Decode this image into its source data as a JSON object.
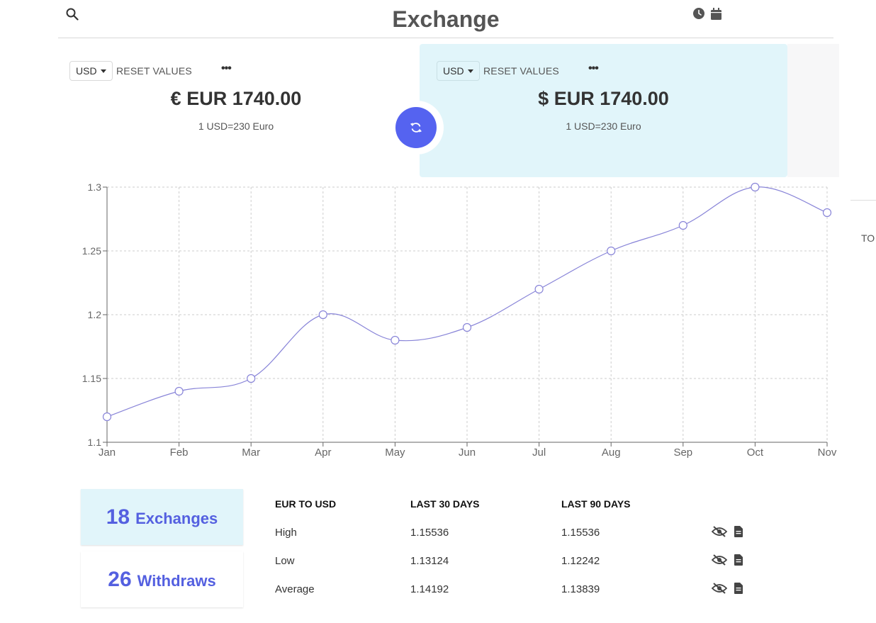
{
  "header": {
    "title": "Exchange",
    "search_icon": "search-icon",
    "history_icon": "clock-icon",
    "calendar_icon": "calendar-icon"
  },
  "from_panel": {
    "currency": "USD",
    "reset_label": "RESET VALUES",
    "more_label": "•••",
    "symbol": "€",
    "amount": "EUR 1740.00",
    "rate": "1 USD=230 Euro"
  },
  "to_panel": {
    "currency": "USD",
    "reset_label": "RESET VALUES",
    "more_label": "•••",
    "symbol": "$",
    "amount": "EUR 1740.00",
    "rate": "1 USD=230 Euro"
  },
  "side": {
    "to_label": "TO"
  },
  "colors": {
    "accent": "#5563f0",
    "line": "#8884d8",
    "panel_highlight": "#e1f5fa"
  },
  "chart_data": {
    "type": "line",
    "categories": [
      "Jan",
      "Feb",
      "Mar",
      "Apr",
      "May",
      "Jun",
      "Jul",
      "Aug",
      "Sep",
      "Oct",
      "Nov"
    ],
    "series": [
      {
        "values": [
          1.12,
          1.14,
          1.15,
          1.2,
          1.18,
          1.19,
          1.22,
          1.25,
          1.27,
          1.3,
          1.28
        ]
      }
    ],
    "yticks": [
      "1.1",
      "1.15",
      "1.2",
      "1.25",
      "1.3"
    ],
    "ylim": [
      1.1,
      1.3
    ],
    "grid": true,
    "curve": "smooth"
  },
  "stats": {
    "exchanges_count": "18",
    "exchanges_label": "Exchanges",
    "withdraws_count": "26",
    "withdraws_label": "Withdraws"
  },
  "table": {
    "headers": [
      "EUR TO USD",
      "LAST 30 DAYS",
      "LAST 90 DAYS"
    ],
    "rows": [
      {
        "label": "High",
        "d30": "1.15536",
        "d90": "1.15536"
      },
      {
        "label": "Low",
        "d30": "1.13124",
        "d90": "1.12242"
      },
      {
        "label": "Average",
        "d30": "1.14192",
        "d90": "1.13839"
      }
    ],
    "row_icons": [
      "eye-slash-icon",
      "document-icon"
    ]
  }
}
